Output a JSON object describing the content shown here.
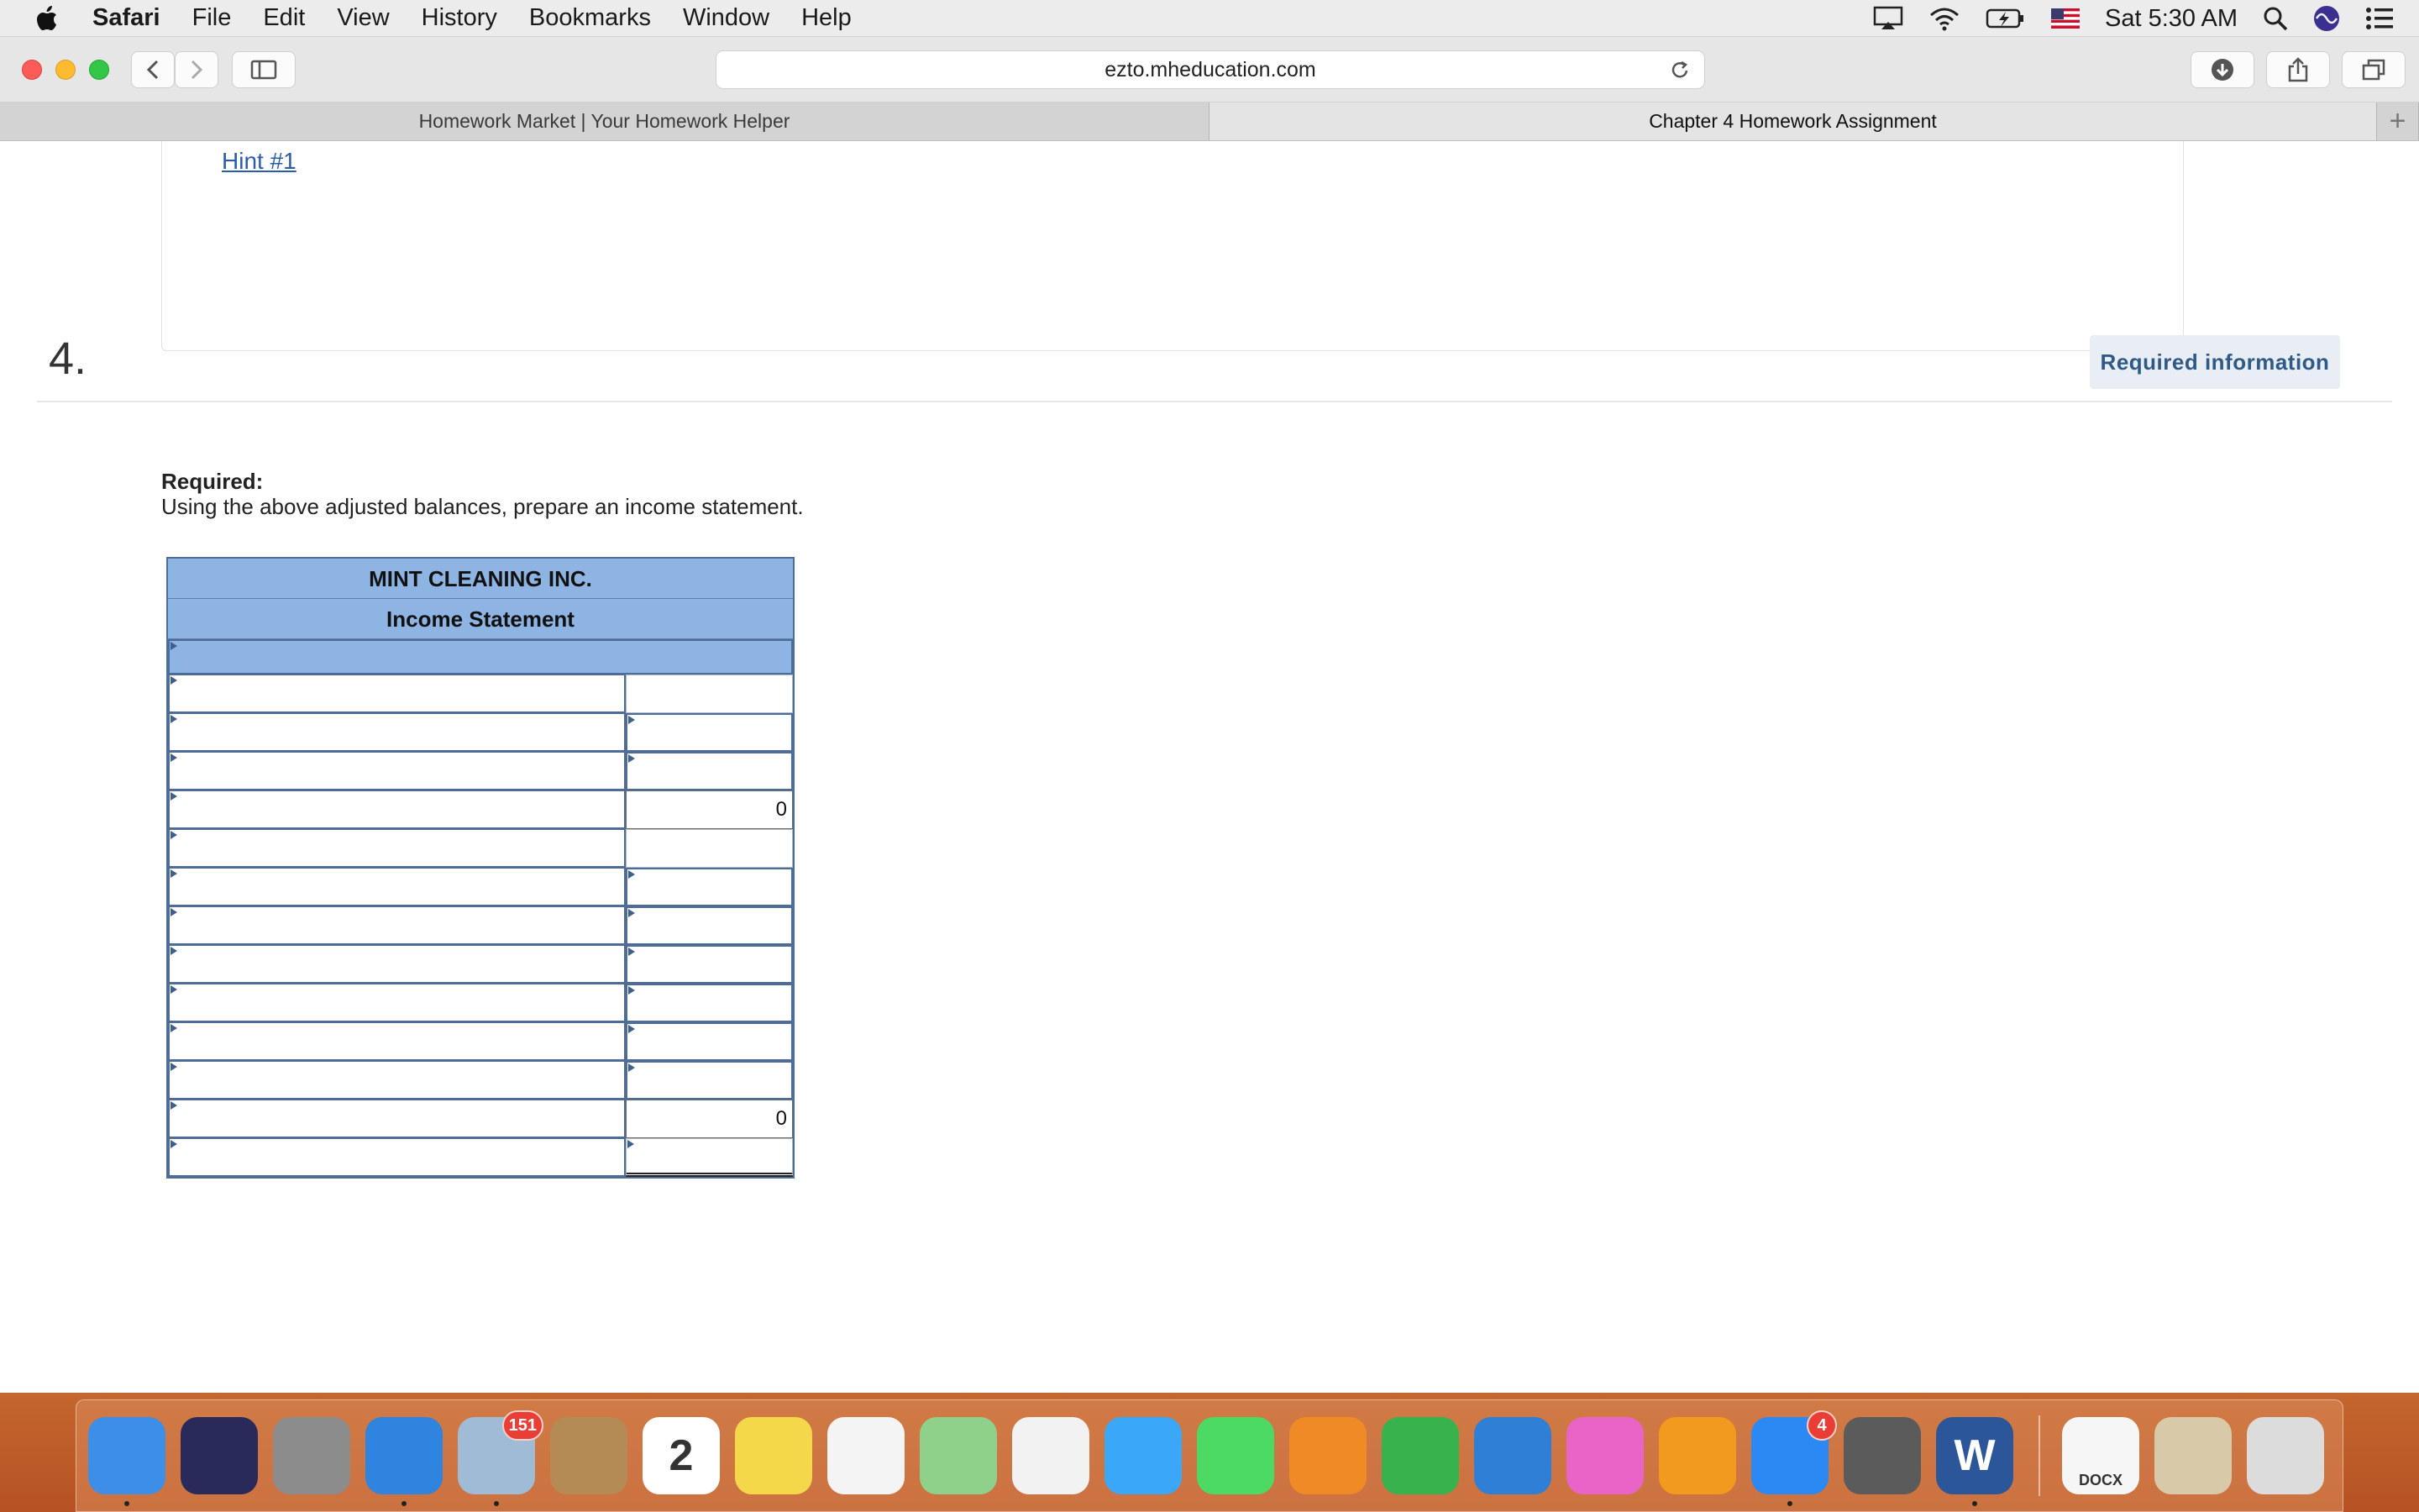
{
  "menubar": {
    "app_name": "Safari",
    "menus": [
      "File",
      "Edit",
      "View",
      "History",
      "Bookmarks",
      "Window",
      "Help"
    ],
    "clock": "Sat 5:30 AM"
  },
  "browser": {
    "url": "ezto.mheducation.com",
    "tabs": [
      {
        "label": "Homework Market | Your Homework Helper",
        "active": false
      },
      {
        "label": "Chapter 4 Homework Assignment",
        "active": true
      }
    ],
    "new_tab_label": "+"
  },
  "page": {
    "hint_link": "Hint #1",
    "question_number": "4.",
    "required_info_button": "Required information",
    "required_label": "Required:",
    "required_text": "Using the above adjusted balances, prepare an income statement."
  },
  "worksheet": {
    "company": "MINT CLEANING INC.",
    "statement": "Income Statement",
    "rows": [
      {
        "label": "",
        "amount": "",
        "amount_type": "plain"
      },
      {
        "label": "",
        "amount": "",
        "amount_type": "input"
      },
      {
        "label": "",
        "amount": "",
        "amount_type": "input"
      },
      {
        "label": "",
        "amount": "0",
        "amount_type": "total"
      },
      {
        "label": "",
        "amount": "",
        "amount_type": "plain"
      },
      {
        "label": "",
        "amount": "",
        "amount_type": "input"
      },
      {
        "label": "",
        "amount": "",
        "amount_type": "input"
      },
      {
        "label": "",
        "amount": "",
        "amount_type": "input"
      },
      {
        "label": "",
        "amount": "",
        "amount_type": "input"
      },
      {
        "label": "",
        "amount": "",
        "amount_type": "input"
      },
      {
        "label": "",
        "amount": "",
        "amount_type": "input"
      },
      {
        "label": "",
        "amount": "0",
        "amount_type": "total"
      },
      {
        "label": "",
        "amount": "",
        "amount_type": "dbl"
      }
    ]
  },
  "dock": {
    "apps": [
      {
        "name": "finder-icon",
        "color": "#3d8ee6",
        "running": true
      },
      {
        "name": "siri-icon",
        "color": "#2a2a5a",
        "running": false
      },
      {
        "name": "launchpad-icon",
        "color": "#8c8c8c",
        "running": false
      },
      {
        "name": "safari-icon",
        "color": "#2f84e0",
        "running": true
      },
      {
        "name": "mail-icon",
        "color": "#9fbbd6",
        "running": true,
        "badge": "151"
      },
      {
        "name": "contacts-icon",
        "color": "#b48a55",
        "running": false
      },
      {
        "name": "calendar-icon",
        "color": "#ffffff",
        "running": false,
        "text": "2"
      },
      {
        "name": "notes-icon",
        "color": "#f5d84a",
        "running": false
      },
      {
        "name": "reminders-icon",
        "color": "#f4f4f4",
        "running": false
      },
      {
        "name": "maps-icon",
        "color": "#8fd18a",
        "running": false
      },
      {
        "name": "photos-icon",
        "color": "#f2f2f2",
        "running": false
      },
      {
        "name": "messages-icon",
        "color": "#3aa8f6",
        "running": false
      },
      {
        "name": "facetime-icon",
        "color": "#4cd964",
        "running": false
      },
      {
        "name": "pages-icon",
        "color": "#f08a24",
        "running": false
      },
      {
        "name": "numbers-icon",
        "color": "#37b24d",
        "running": false
      },
      {
        "name": "keynote-icon",
        "color": "#2f7fd6",
        "running": false
      },
      {
        "name": "itunes-icon",
        "color": "#e865c7",
        "running": false
      },
      {
        "name": "ibooks-icon",
        "color": "#f29a1e",
        "running": false
      },
      {
        "name": "app-store-icon",
        "color": "#2c88f2",
        "running": true,
        "badge": "4"
      },
      {
        "name": "system-preferences-icon",
        "color": "#5b5b5b",
        "running": false
      },
      {
        "name": "word-icon",
        "color": "#2b579a",
        "running": true,
        "text": "W"
      }
    ],
    "stack": [
      {
        "name": "docx-document-icon",
        "color": "#f6f6f6",
        "text": "DOCX"
      },
      {
        "name": "downloads-stack-icon",
        "color": "#d8c9a8"
      },
      {
        "name": "trash-icon",
        "color": "#dcdcdc"
      }
    ]
  }
}
